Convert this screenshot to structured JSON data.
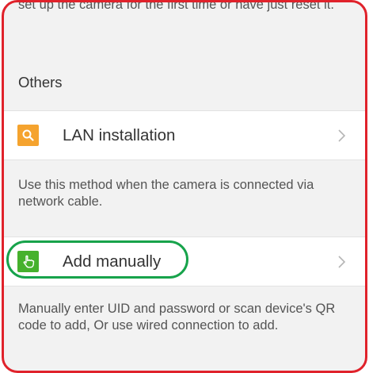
{
  "colors": {
    "frame_border": "#e0222b",
    "highlight_border": "#17a34b",
    "lan_icon_bg": "#f5a32e",
    "manual_icon_bg": "#46b12d"
  },
  "intro_text": "set up the camera for the first time or have just reset it.",
  "section_title": "Others",
  "lan": {
    "icon": "search-icon",
    "label": "LAN installation",
    "description": "Use this method when the camera is connected via network cable."
  },
  "manual": {
    "icon": "hand-pointer-icon",
    "label": "Add manually",
    "description": "Manually enter UID and password or scan device's QR code to add, Or use wired connection to add."
  }
}
